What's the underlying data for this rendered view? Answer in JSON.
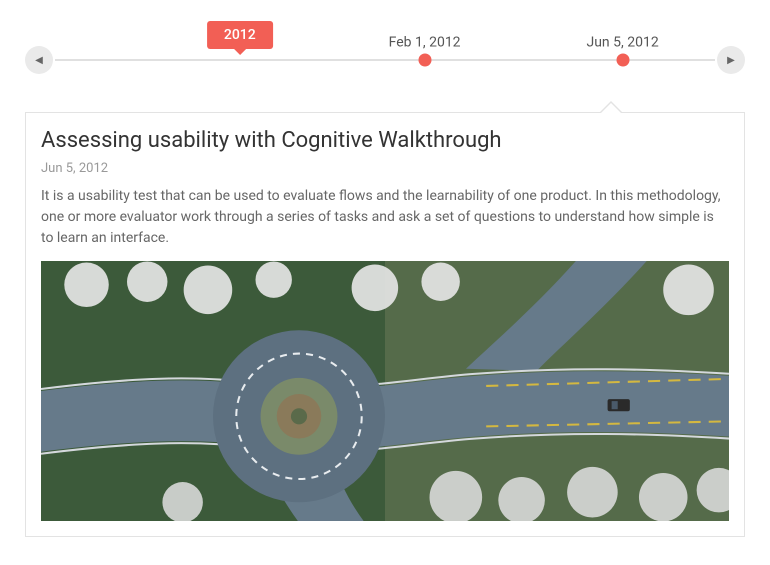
{
  "timeline": {
    "year_badge": "2012",
    "year_position_pct": 28,
    "events": [
      {
        "label": "Feb 1, 2012",
        "position_pct": 56
      },
      {
        "label": "Jun 5, 2012",
        "position_pct": 86
      }
    ]
  },
  "card": {
    "title": "Assessing usability with Cognitive Walkthrough",
    "date": "Jun 5, 2012",
    "body": "It is a usability test that can be used to evaluate flows and the learnability of one product. In this methodology, one or more evaluator work through a series of tasks and ask a set of questions to understand how simple is to learn an interface."
  }
}
